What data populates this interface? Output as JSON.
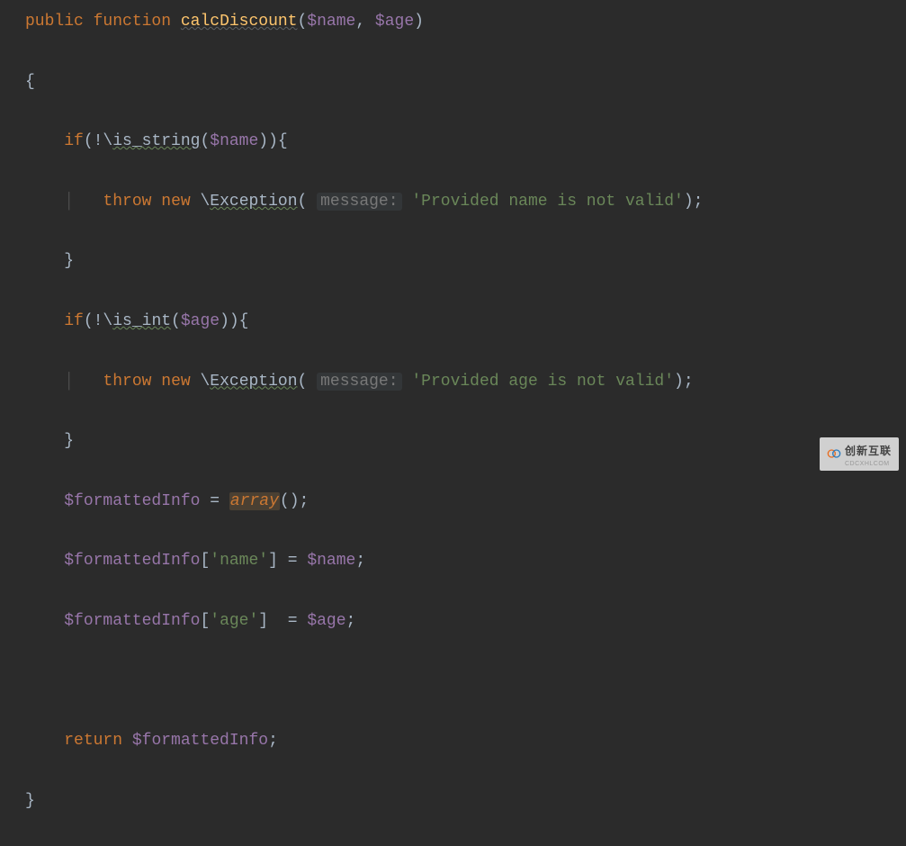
{
  "code": {
    "kw_public": "public",
    "kw_function": "function",
    "fn_name": "calcDiscount",
    "param_name": "$name",
    "param_age": "$age",
    "kw_if": "if",
    "fn_is_string": "is_string",
    "fn_is_int": "is_int",
    "kw_throw": "throw",
    "kw_new": "new",
    "cls_exception": "Exception",
    "hint_message": "message:",
    "str_name_err": "'Provided name is not valid'",
    "str_age_err": "'Provided age is not valid'",
    "var_formatted": "$formattedInfo",
    "kw_array": "array",
    "key_name": "'name'",
    "key_age": "'age'",
    "kw_return": "return"
  },
  "watermark": {
    "main": "创新互联",
    "sub": "CDCXHLCOM"
  }
}
